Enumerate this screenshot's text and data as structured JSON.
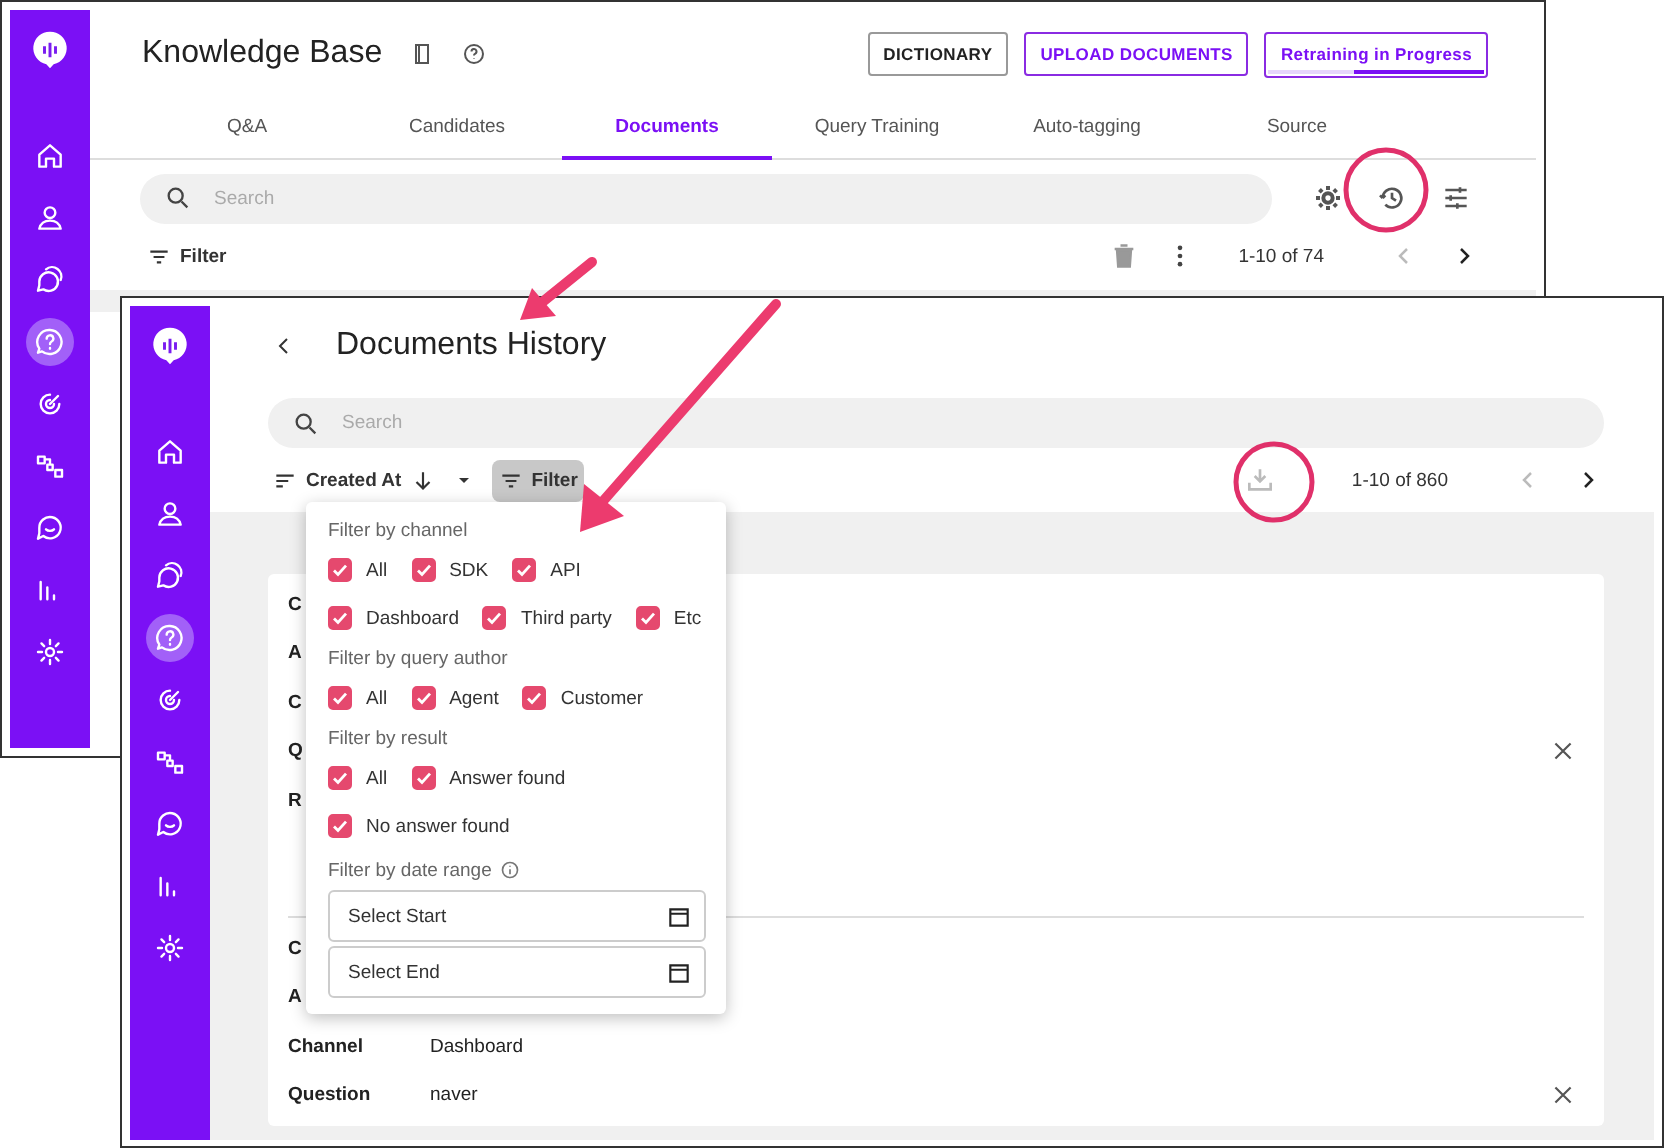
{
  "back_window": {
    "sidebar": {
      "items": [
        {
          "selected": false
        },
        {
          "selected": false
        },
        {
          "selected": false
        },
        {
          "selected": true
        },
        {
          "selected": false
        },
        {
          "selected": false
        },
        {
          "selected": false
        },
        {
          "selected": false
        },
        {
          "selected": false
        }
      ]
    },
    "title": "Knowledge Base",
    "buttons": [
      "DICTIONARY",
      "UPLOAD DOCUMENTS"
    ],
    "retraining": {
      "label": "Retraining in Progress",
      "level": 0.6
    },
    "tabs": [
      {
        "label": "Q&A",
        "selected": false
      },
      {
        "label": "Candidates",
        "selected": false
      },
      {
        "label": "Documents",
        "selected": true
      },
      {
        "label": "Query Training",
        "selected": false
      },
      {
        "label": "Auto-tagging",
        "selected": false
      },
      {
        "label": "Source",
        "selected": false
      }
    ],
    "search": {
      "placeholder": "Search"
    },
    "filter": "Filter",
    "pagination": "1-10 of 74"
  },
  "front_window": {
    "sidebar": {
      "items": [
        {
          "selected": false
        },
        {
          "selected": false
        },
        {
          "selected": false
        },
        {
          "selected": true
        },
        {
          "selected": false
        },
        {
          "selected": false
        },
        {
          "selected": false
        },
        {
          "selected": false
        },
        {
          "selected": false
        }
      ]
    },
    "title": "Documents History",
    "search": {
      "placeholder": "Search"
    },
    "sort": {
      "label": "Created At"
    },
    "filter_button": "Filter",
    "pagination": "1-10 of 860",
    "filter_menu": {
      "sections": [
        {
          "heading": "Filter by channel",
          "options": [
            {
              "label": "All",
              "checked": true
            },
            {
              "label": "SDK",
              "checked": true
            },
            {
              "label": "API",
              "checked": true
            },
            {
              "label": "Dashboard",
              "checked": true
            },
            {
              "label": "Third party",
              "checked": true
            },
            {
              "label": "Etc",
              "checked": true
            }
          ]
        },
        {
          "heading": "Filter by query author",
          "options": [
            {
              "label": "All",
              "checked": true
            },
            {
              "label": "Agent",
              "checked": true
            },
            {
              "label": "Customer",
              "checked": true
            }
          ]
        },
        {
          "heading": "Filter by result",
          "options": [
            {
              "label": "All",
              "checked": true
            },
            {
              "label": "Answer found",
              "checked": true
            },
            {
              "label": "No answer found",
              "checked": true
            }
          ]
        }
      ],
      "date_range": {
        "heading": "Filter by date range",
        "start": {
          "placeholder": "Select Start"
        },
        "end": {
          "placeholder": "Select End"
        }
      }
    },
    "records": [
      {
        "fields": [
          {
            "label": "C",
            "closable": false
          },
          {
            "label": "A",
            "closable": false
          },
          {
            "label": "C",
            "closable": false
          },
          {
            "label": "Q",
            "closable": true
          },
          {
            "label": "R",
            "closable": false
          }
        ]
      },
      {
        "fields": [
          {
            "label": "C",
            "closable": false
          },
          {
            "label": "A",
            "closable": false
          },
          {
            "label": "Channel",
            "value": "Dashboard",
            "closable": false
          },
          {
            "label": "Question",
            "value": "naver",
            "closable": true
          }
        ]
      }
    ]
  }
}
